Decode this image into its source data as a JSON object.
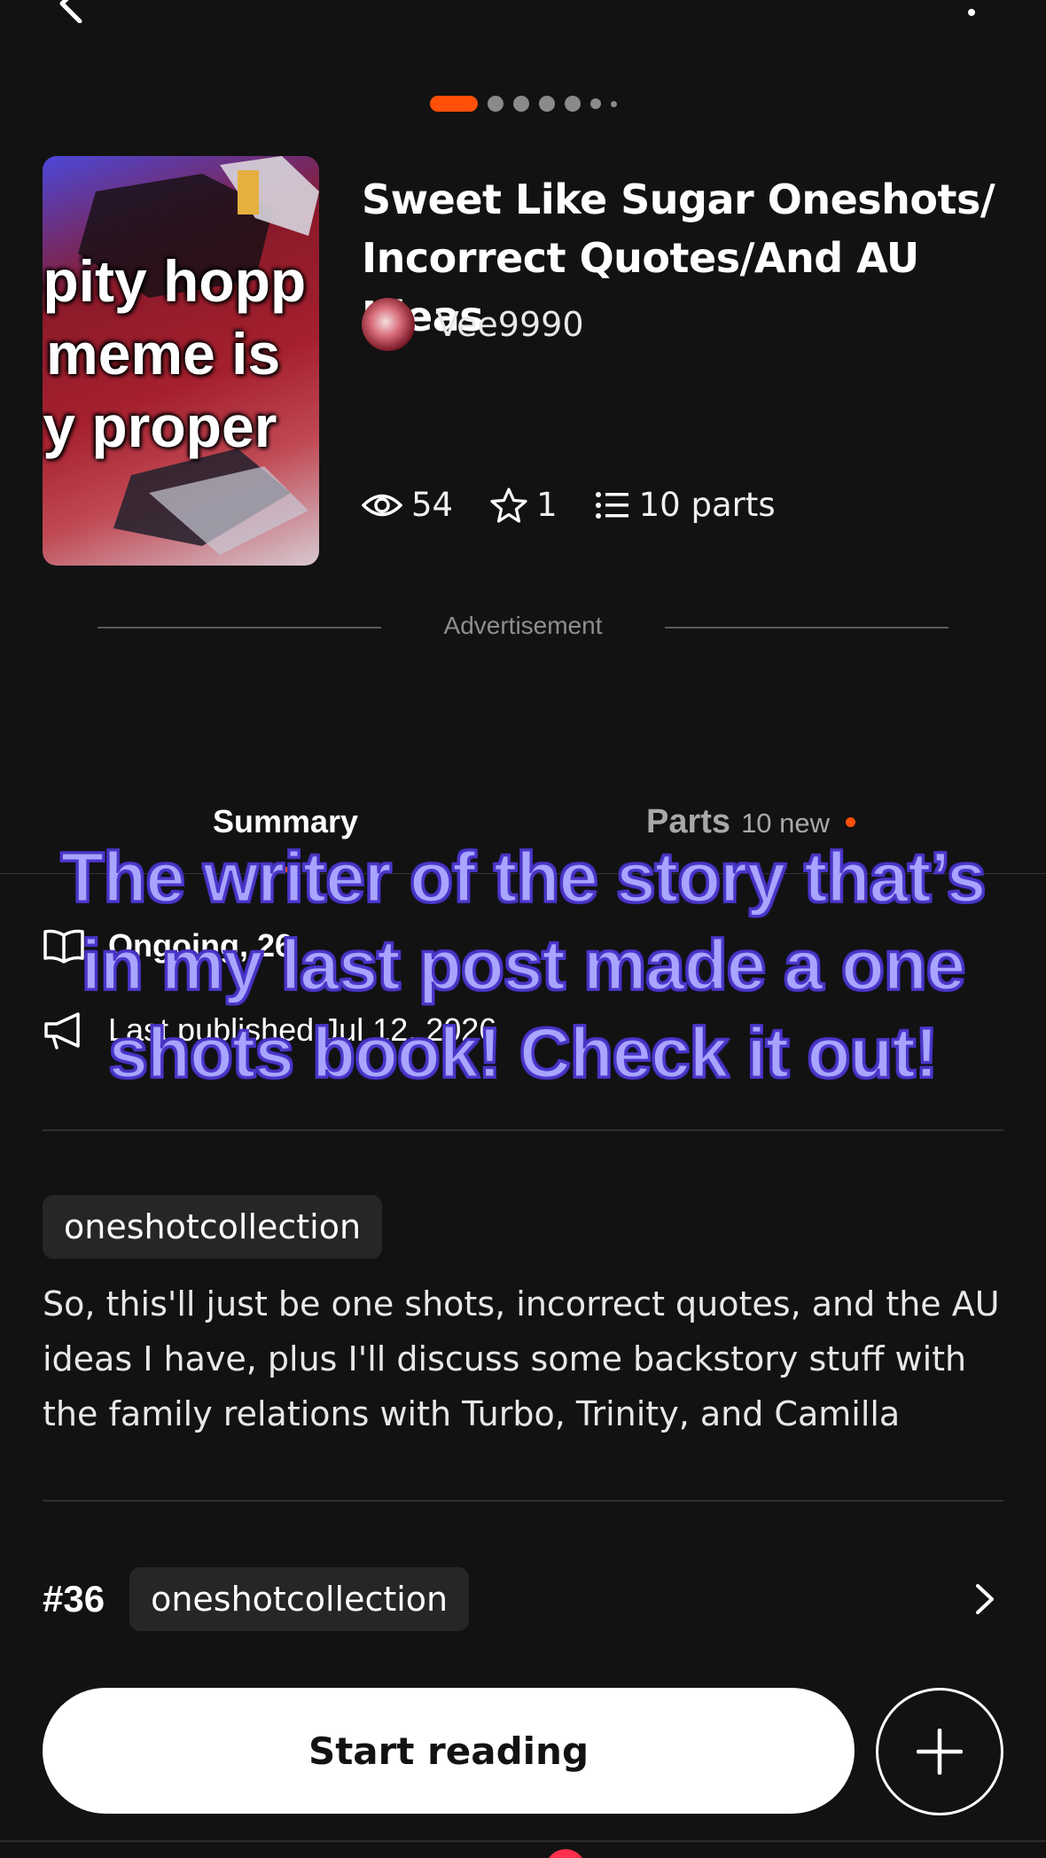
{
  "story": {
    "title": "Sweet Like Sugar Oneshots/ Incorrect Quotes/And AU Ideas",
    "author": "Vee9990",
    "cover_text": [
      "opity hopp",
      "r meme is",
      "ny proper"
    ],
    "stats": {
      "reads": "54",
      "votes": "1",
      "parts": "10 parts"
    }
  },
  "pager": {
    "total": 7,
    "active_index": 0
  },
  "ad": {
    "label": "Advertisement"
  },
  "tabs": {
    "summary": "Summary",
    "parts": "Parts",
    "parts_new": "10 new"
  },
  "info": {
    "status": "Ongoing, 26",
    "published": "Last published Jul 12, 2026"
  },
  "tag": "oneshotcollection",
  "description": "So, this'll just be one shots, incorrect quotes, and the AU ideas I have, plus I'll discuss some backstory stuff with the family relations with Turbo, Trinity, and Camilla",
  "ranking": {
    "rank": "#36",
    "tag": "oneshotcollection"
  },
  "actions": {
    "start_reading": "Start reading"
  },
  "overlay_caption": "The writer of the story that’s in my last post made a one shots book! Check it out!",
  "colors": {
    "accent": "#ff500a",
    "background": "#121212",
    "caption": "#a9a4ff",
    "caption_outline": "#4a36c8"
  },
  "icons": [
    "back-arrow-icon",
    "more-vertical-icon",
    "eye-icon",
    "star-icon",
    "list-icon",
    "book-open-icon",
    "megaphone-icon",
    "chevron-right-icon",
    "plus-icon"
  ]
}
